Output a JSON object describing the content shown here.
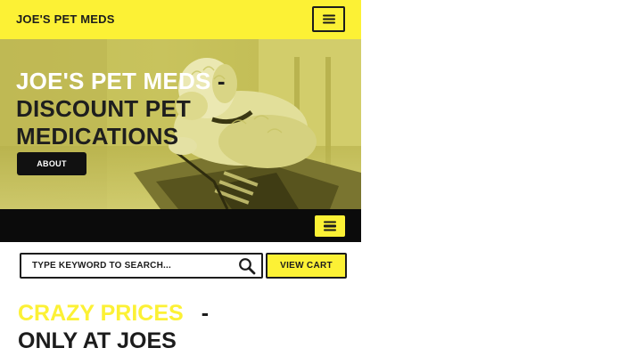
{
  "header": {
    "brand": "JOE'S PET MEDS",
    "menu_icon": "hamburger-icon"
  },
  "hero": {
    "title_part1": "JOE'S PET MEDS",
    "title_part2": " - DISCOUNT PET MEDICATIONS",
    "about_button": "ABOUT",
    "image": "dog-photo"
  },
  "nav": {
    "menu_icon": "hamburger-icon"
  },
  "search": {
    "placeholder": "TYPE KEYWORD TO SEARCH...",
    "icon": "search-icon",
    "view_cart": "VIEW CART"
  },
  "promo": {
    "highlight": "CRAZY PRICES",
    "separator": "-",
    "rest": "ONLY AT JOES"
  },
  "colors": {
    "accent": "#fcf135",
    "dark": "#1c1c1c",
    "nav_bg": "#0b0b0b"
  }
}
